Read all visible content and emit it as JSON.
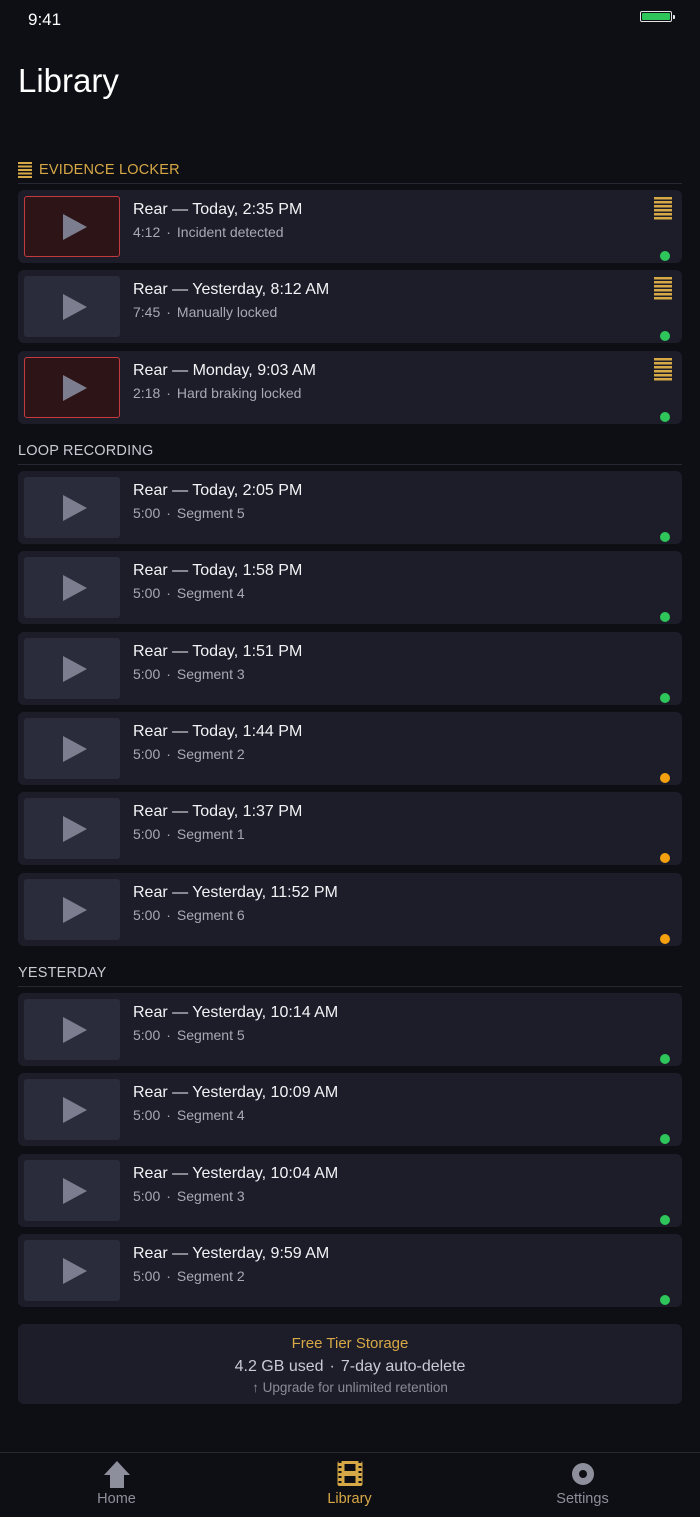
{
  "status_bar": {
    "time": "9:41"
  },
  "page_title": "Library",
  "colors": {
    "accent": "#d7a846",
    "online": "#2ec55a",
    "pending": "#f5a10f",
    "incident_border": "#c53a3e"
  },
  "sections": [
    {
      "key": "evidence",
      "header": "EVIDENCE LOCKER",
      "clips": [
        {
          "title": "Rear — Today, 2:35 PM",
          "duration": "4:12",
          "detail": "Incident detected",
          "incident": true,
          "locked": true,
          "status": "online"
        },
        {
          "title": "Rear — Yesterday, 8:12 AM",
          "duration": "7:45",
          "detail": "Manually locked",
          "incident": false,
          "locked": true,
          "status": "online"
        },
        {
          "title": "Rear — Monday, 9:03 AM",
          "duration": "2:18",
          "detail": "Hard braking locked",
          "incident": true,
          "locked": true,
          "status": "online"
        }
      ]
    },
    {
      "key": "loop",
      "header": "LOOP RECORDING",
      "clips": [
        {
          "title": "Rear — Today, 2:05 PM",
          "duration": "5:00",
          "detail": "Segment 5",
          "incident": false,
          "locked": false,
          "status": "online"
        },
        {
          "title": "Rear — Today, 1:58 PM",
          "duration": "5:00",
          "detail": "Segment 4",
          "incident": false,
          "locked": false,
          "status": "online"
        },
        {
          "title": "Rear — Today, 1:51 PM",
          "duration": "5:00",
          "detail": "Segment 3",
          "incident": false,
          "locked": false,
          "status": "online"
        },
        {
          "title": "Rear — Today, 1:44 PM",
          "duration": "5:00",
          "detail": "Segment 2",
          "incident": false,
          "locked": false,
          "status": "pending"
        },
        {
          "title": "Rear — Today, 1:37 PM",
          "duration": "5:00",
          "detail": "Segment 1",
          "incident": false,
          "locked": false,
          "status": "pending"
        },
        {
          "title": "Rear — Yesterday, 11:52 PM",
          "duration": "5:00",
          "detail": "Segment 6",
          "incident": false,
          "locked": false,
          "status": "pending"
        }
      ]
    },
    {
      "key": "yesterday",
      "header": "YESTERDAY",
      "clips": [
        {
          "title": "Rear — Yesterday, 10:14 AM",
          "duration": "5:00",
          "detail": "Segment 5",
          "incident": false,
          "locked": false,
          "status": "online"
        },
        {
          "title": "Rear — Yesterday, 10:09 AM",
          "duration": "5:00",
          "detail": "Segment 4",
          "incident": false,
          "locked": false,
          "status": "online"
        },
        {
          "title": "Rear — Yesterday, 10:04 AM",
          "duration": "5:00",
          "detail": "Segment 3",
          "incident": false,
          "locked": false,
          "status": "online"
        },
        {
          "title": "Rear — Yesterday, 9:59 AM",
          "duration": "5:00",
          "detail": "Segment 2",
          "incident": false,
          "locked": false,
          "status": "online"
        }
      ]
    }
  ],
  "storage": {
    "title": "Free Tier Storage",
    "used": "4.2 GB used",
    "retention": "7-day auto-delete",
    "upgrade": "↑ Upgrade for unlimited retention"
  },
  "tabs": [
    {
      "key": "home",
      "label": "Home",
      "icon": "home-icon",
      "active": false
    },
    {
      "key": "library",
      "label": "Library",
      "icon": "film-icon",
      "active": true
    },
    {
      "key": "settings",
      "label": "Settings",
      "icon": "gear-icon",
      "active": false
    }
  ]
}
